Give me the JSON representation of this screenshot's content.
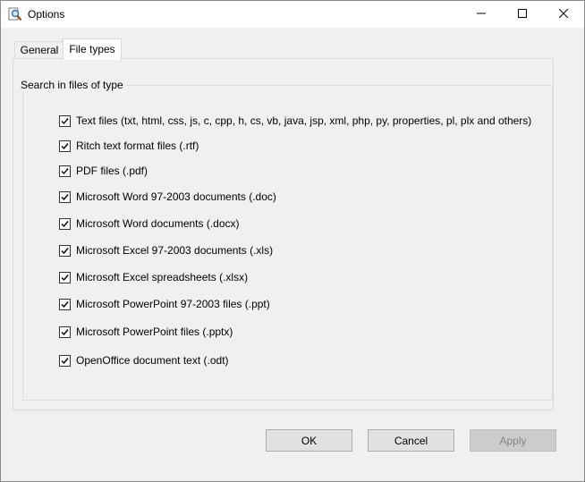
{
  "window": {
    "title": "Options"
  },
  "tabs": [
    {
      "label": "General",
      "selected": false
    },
    {
      "label": "File types",
      "selected": true
    }
  ],
  "group": {
    "legend": "Search in files of type",
    "checkboxes": [
      {
        "label": "Text files (txt, html, css, js, c, cpp, h, cs, vb, java, jsp, xml, php, py, properties, pl, plx and others)",
        "checked": true
      },
      {
        "label": "Ritch text format files (.rtf)",
        "checked": true
      },
      {
        "label": "PDF files (.pdf)",
        "checked": true
      },
      {
        "label": "Microsoft Word 97-2003 documents (.doc)",
        "checked": true
      },
      {
        "label": "Microsoft Word documents (.docx)",
        "checked": true
      },
      {
        "label": "Microsoft Excel 97-2003 documents (.xls)",
        "checked": true
      },
      {
        "label": "Microsoft Excel spreadsheets (.xlsx)",
        "checked": true
      },
      {
        "label": "Microsoft PowerPoint 97-2003 files (.ppt)",
        "checked": true
      },
      {
        "label": "Microsoft PowerPoint files (.pptx)",
        "checked": true
      },
      {
        "label": "OpenOffice document text (.odt)",
        "checked": true
      }
    ]
  },
  "buttons": {
    "ok": "OK",
    "cancel": "Cancel",
    "apply": "Apply",
    "apply_enabled": false
  },
  "icons": {
    "app": "magnifier-document-icon",
    "minimize": "minimize-icon",
    "maximize": "maximize-icon",
    "close": "close-icon",
    "check": "checkmark-icon"
  }
}
